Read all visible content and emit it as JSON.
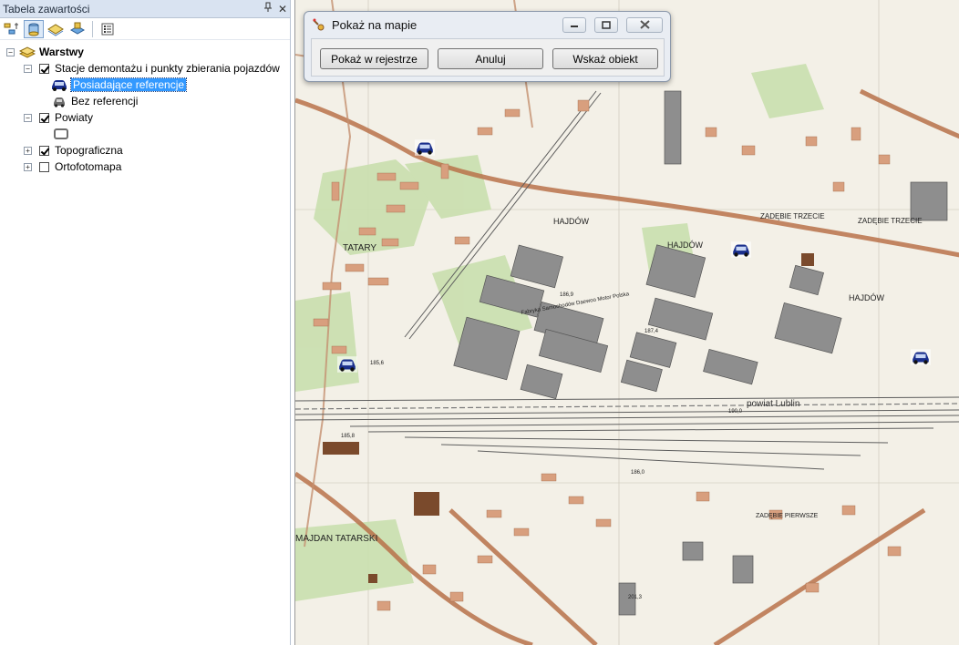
{
  "toc": {
    "title": "Tabela zawartości",
    "pin_glyph": "ꟷ",
    "close_glyph": "✕",
    "toolbar": [
      {
        "name": "list-by-drawing-order-icon"
      },
      {
        "name": "list-by-source-icon",
        "active": true
      },
      {
        "name": "list-by-visibility-icon"
      },
      {
        "name": "list-by-selection-icon"
      },
      {
        "name": "options-icon"
      }
    ],
    "tree": {
      "root_label": "Warstwy",
      "layer1_label": "Stacje demontażu i punkty zbierania pojazdów",
      "layer1_class1_label": "Posiadające referencje",
      "layer1_class2_label": "Bez referencji",
      "layer2_label": "Powiaty",
      "layer3_label": "Topograficzna",
      "layer4_label": "Ortofotomapa",
      "expander_minus": "−",
      "expander_plus": "+"
    }
  },
  "map": {
    "labels": {
      "hajdow_1": "HAJDÓW",
      "hajdow_2": "HAJDÓW",
      "hajdow_3": "HAJDÓW",
      "tatary": "TATARY",
      "zadebie_trzecie_1": "ZADĘBIE TRZECIE",
      "zadebie_trzecie_2": "ZADĘBIE TRZECIE",
      "zadebie_pierwsze": "ZADĘBIE PIERWSZE",
      "majdan_tatarski": "MAJDAN TATARSKI",
      "fabryka": "Fabryka Samochodów Daewoo Motor Polska",
      "powiat_lublin": "powiat Lublin",
      "elev_1": "186,9",
      "elev_2": "185,6",
      "elev_3": "187,4",
      "elev_4": "190,0",
      "elev_5": "185,8",
      "elev_6": "186,0",
      "elev_7": "201,3"
    }
  },
  "dialog": {
    "title": "Pokaż na mapie",
    "buttons": {
      "show_in_register": "Pokaż w rejestrze",
      "cancel": "Anuluj",
      "identify": "Wskaż obiekt"
    }
  }
}
